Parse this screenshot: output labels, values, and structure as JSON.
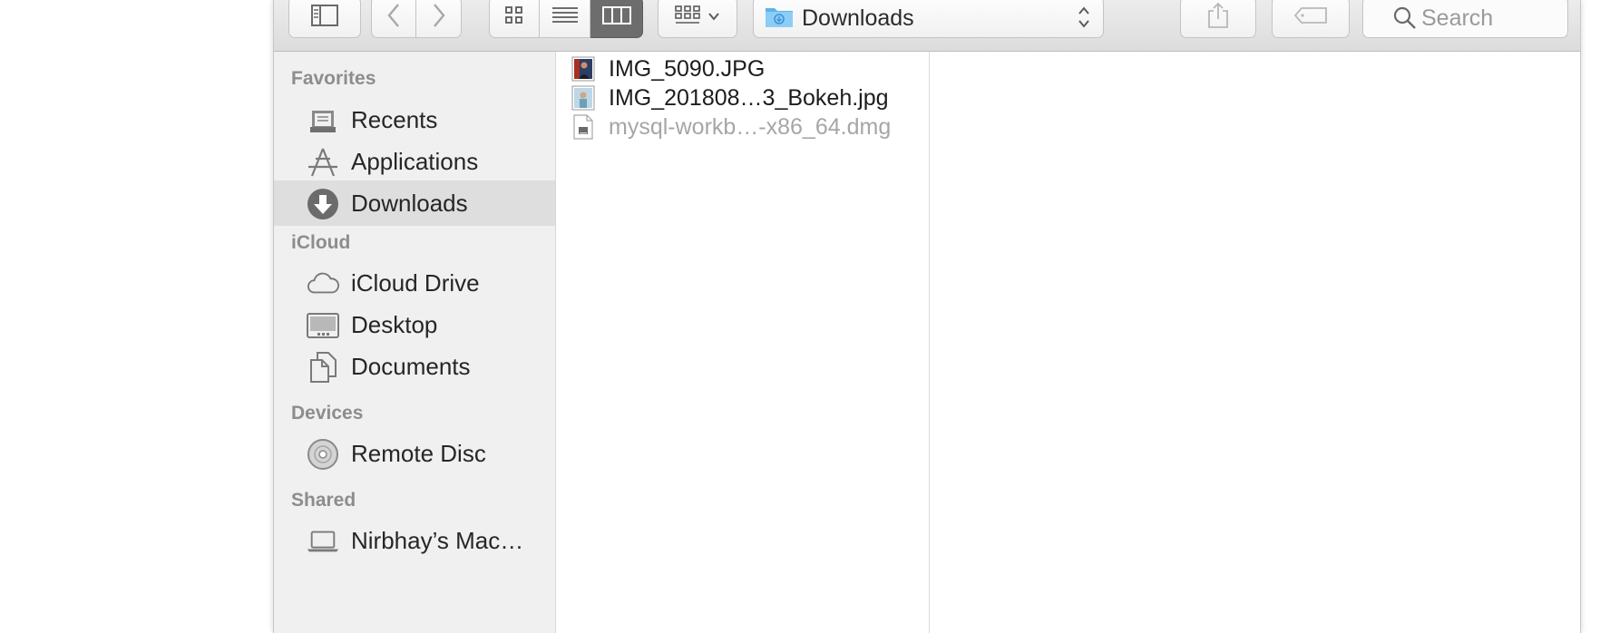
{
  "toolbar": {
    "path_title": "Downloads",
    "search_placeholder": "Search",
    "view_modes": [
      "icon",
      "list",
      "column"
    ],
    "active_view": "column"
  },
  "sidebar": {
    "sections": [
      {
        "title": "Favorites",
        "items": [
          {
            "label": "Recents",
            "icon": "recents-icon"
          },
          {
            "label": "Applications",
            "icon": "applications-icon"
          },
          {
            "label": "Downloads",
            "icon": "downloads-icon",
            "selected": true
          }
        ]
      },
      {
        "title": "iCloud",
        "items": [
          {
            "label": "iCloud Drive",
            "icon": "icloud-drive-icon"
          },
          {
            "label": "Desktop",
            "icon": "desktop-icon"
          },
          {
            "label": "Documents",
            "icon": "documents-icon"
          }
        ]
      },
      {
        "title": "Devices",
        "items": [
          {
            "label": "Remote Disc",
            "icon": "remote-disc-icon"
          }
        ]
      },
      {
        "title": "Shared",
        "items": [
          {
            "label": "Nirbhay’s Mac…",
            "icon": "laptop-icon"
          }
        ]
      }
    ]
  },
  "files": [
    {
      "name": "IMG_5090.JPG",
      "icon": "jpg-thumbnail-icon",
      "dimmed": false
    },
    {
      "name": "IMG_201808…3_Bokeh.jpg",
      "icon": "jpg-thumbnail-icon",
      "dimmed": false
    },
    {
      "name": "mysql-workb…-x86_64.dmg",
      "icon": "dmg-file-icon",
      "dimmed": true
    }
  ],
  "colors": {
    "toolbar_bg": "#e2e2e2",
    "sidebar_bg": "#f0f0f0",
    "selection_bg": "#dedede",
    "section_header": "#8d8d8d",
    "folder_blue": "#5fb3ec"
  }
}
